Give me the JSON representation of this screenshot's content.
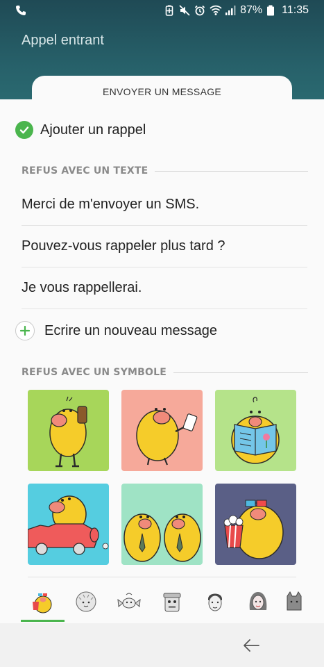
{
  "status_bar": {
    "battery_percent": "87%",
    "time": "11:35",
    "icons": [
      "phone-icon",
      "battery-saver-icon",
      "mute-icon",
      "alarm-icon",
      "wifi-icon",
      "signal-icon",
      "battery-icon"
    ]
  },
  "call": {
    "title": "Appel entrant"
  },
  "sheet": {
    "tab_title": "ENVOYER UN MESSAGE",
    "reminder_label": "Ajouter un rappel",
    "text_section_title": "REFUS AVEC UN TEXTE",
    "messages": [
      "Merci de m'envoyer un SMS.",
      "Pouvez-vous rappeler plus tard ?",
      "Je vous rappellerai."
    ],
    "new_message_label": "Ecrire un nouveau message",
    "symbol_section_title": "REFUS AVEC UN SYMBOLE"
  },
  "stickers": [
    {
      "name": "sticker-phone-call",
      "bg": "#a7d65a"
    },
    {
      "name": "sticker-smartphone",
      "bg": "#f6a99a"
    },
    {
      "name": "sticker-reading-book",
      "bg": "#b5e38a"
    },
    {
      "name": "sticker-driving-car",
      "bg": "#55cde0"
    },
    {
      "name": "sticker-meeting",
      "bg": "#9fe3c5"
    },
    {
      "name": "sticker-movie-popcorn",
      "bg": "#5a5f86"
    }
  ],
  "sticker_tabs": [
    "chick-pack-icon",
    "hedgehog-pack-icon",
    "candy-pack-icon",
    "robot-pack-icon",
    "man-pack-icon",
    "woman-pack-icon",
    "cat-pack-icon"
  ],
  "colors": {
    "accent": "#4ab54d",
    "header": "#1f4a55"
  }
}
